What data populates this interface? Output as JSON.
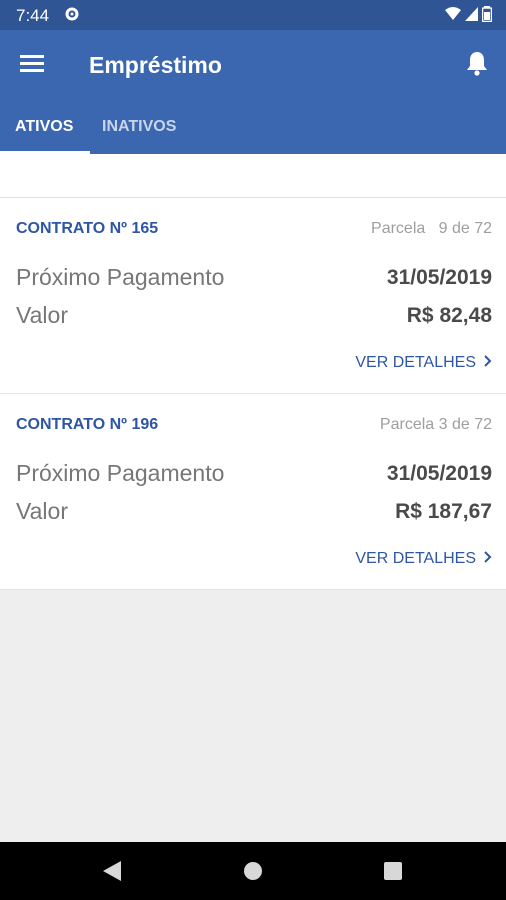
{
  "status_bar": {
    "time": "7:44",
    "icons": [
      "gear-icon",
      "wifi-icon",
      "signal-icon",
      "battery-icon"
    ]
  },
  "app_bar": {
    "title": "Empréstimo",
    "menu_icon": "menu-icon",
    "notification_icon": "bell-icon",
    "background_color": "#3b66b0"
  },
  "tabs": [
    {
      "label": "ATIVOS",
      "selected": true
    },
    {
      "label": "INATIVOS",
      "selected": false
    }
  ],
  "contracts": [
    {
      "title": "CONTRATO Nº 165",
      "parcela": "Parcela   9 de 72",
      "next_payment_label": "Próximo Pagamento",
      "next_payment_date": "31/05/2019",
      "value_label": "Valor",
      "value": "R$ 82,48",
      "details_label": "VER DETALHES"
    },
    {
      "title": "CONTRATO Nº 196",
      "parcela": "Parcela 3 de 72",
      "next_payment_label": "Próximo Pagamento",
      "next_payment_date": "31/05/2019",
      "value_label": "Valor",
      "value": "R$ 187,67",
      "details_label": "VER DETALHES"
    }
  ],
  "nav_bar": {
    "buttons": [
      "back-icon",
      "home-icon",
      "recents-icon"
    ]
  },
  "colors": {
    "accent": "#2e56a4",
    "status_bar": "#2f5595"
  }
}
